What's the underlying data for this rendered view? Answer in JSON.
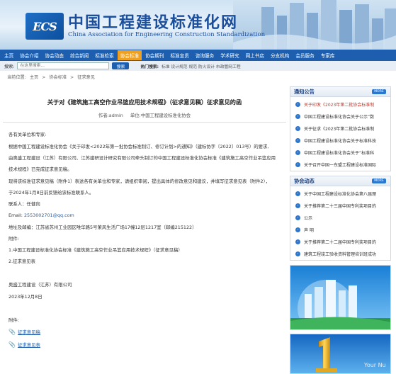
{
  "header": {
    "logo_text": "ECS",
    "site_title": "中国工程建设标准化网",
    "site_subtitle": "China Association for Engineering Construction Standardization"
  },
  "nav": {
    "items": [
      {
        "label": "主页"
      },
      {
        "label": "协会介绍"
      },
      {
        "label": "协会动态"
      },
      {
        "label": "综合新闻"
      },
      {
        "label": "标准检索"
      },
      {
        "label": "协会标准",
        "active": true
      },
      {
        "label": "协会期刊"
      },
      {
        "label": "标准宣贯"
      },
      {
        "label": "咨询服务"
      },
      {
        "label": "学术研究"
      },
      {
        "label": "网上书店"
      },
      {
        "label": "分支机构"
      },
      {
        "label": "会员服务"
      },
      {
        "label": "专家库"
      }
    ]
  },
  "search": {
    "label": "搜索:",
    "placeholder": "在这里搜索...",
    "button": "搜索",
    "hot_label": "热门搜索:",
    "hot_terms": "标准 设计规范 规范 防火设计 市政管网工程"
  },
  "breadcrumb": {
    "prefix": "当前位置:",
    "items": [
      "主页",
      "协会标准",
      "征求意见"
    ],
    "sep": ">"
  },
  "article": {
    "title": "关于对《建筑施工高空作业吊篮应用技术规程》（征求意见稿）征求意见的函",
    "author": "作者:admin",
    "unit": "单位:中国工程建设标准化协会",
    "greeting": "各有关单位和专家:",
    "p1_line1": "根据中国工程建设标准化协会《关于印发<2022年第一批协会标准制订、修订计划>的通知》（建标协字〔2022〕013号）的要求,",
    "p1_line2": "由奥盛工程建设（江苏）有限公司、江苏建研设计研究有限公司牵头制订的中国工程建设标准化协会标准《建筑施工高空作业吊篮应用",
    "p1_line3": "技术规程》已完成征求意见稿。",
    "p2_line1": "现将该标准征求意见稿（附件1）表送各有关单位和专家，请组织审阅，提出具体的修改意见和建议，并填写征求意见表（附件2），",
    "p2_line2": "于2024年1月8日前反馈给该标准联系人。",
    "contact": "联系人：任健向",
    "email_label": "Email:",
    "email": "2553002701@qq.com",
    "address": "地址及邮编：江苏省苏州工业园区唯华路5号茉风生活广场17幢12层1217室（邮编215122）",
    "attachments_label": "附件:",
    "attach1": "1.中国工程建设标准化协会标准《建筑施工高空作业吊篮应用技术规程》（征求意见稿）",
    "attach2": "2.征求意见表",
    "signer": "奥盛工程建设（江苏）有限公司",
    "date": "2023年12月8日",
    "files_label": "附件:",
    "file1": "征求意见稿",
    "file2": "征求意见表"
  },
  "sidebar": {
    "notice": {
      "title": "通知公告",
      "more": "MORE",
      "items": [
        "关于印发《2023年第二批协会标准制",
        "中国工程建设标准化协会关于公示“数",
        "关于征求《2023年第二批协会标准制",
        "中国工程建设标准化协会关于标准科技",
        "中国工程建设标准化协会关于“标准科",
        "关于召开中国一东盟工程建设标准国际"
      ]
    },
    "news": {
      "title": "协会动态",
      "more": "MORE",
      "items": [
        "关于中国工程建设标准化协会第八届理",
        "关于推荐第二十三届中国专利奖项目的",
        "公示",
        "声 明",
        "关于推荐第二十二届中国专利奖项目的",
        "建筑工程竣工验收资料管理培训班成功"
      ]
    },
    "ad2_text": "Your Nu"
  },
  "colors": {
    "nav_bg": "#1d5fae",
    "nav_active": "#f0a020",
    "link": "#1d5fae",
    "notice_first": "#c0392b"
  }
}
